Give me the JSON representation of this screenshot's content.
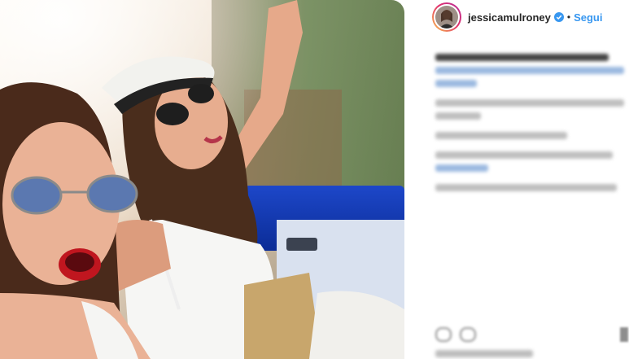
{
  "post": {
    "image_alt": "",
    "icons": {
      "verified": "verified-badge-icon",
      "like": "heart-icon",
      "comment": "comment-icon",
      "share": "share-icon",
      "save": "bookmark-icon"
    }
  },
  "header": {
    "username": "jessicamulroney",
    "separator": "•",
    "follow_label": "Segui"
  },
  "colors": {
    "link": "#3897f0",
    "avatar_ring_start": "#f9c34a",
    "avatar_ring_end": "#b52f9e"
  }
}
